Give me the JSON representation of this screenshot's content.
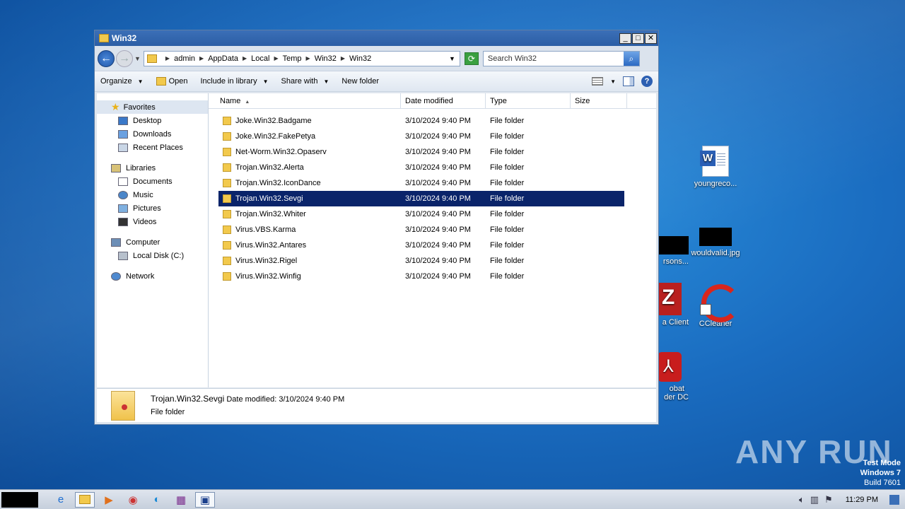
{
  "window": {
    "title": "Win32",
    "controls": {
      "minimize": "_",
      "maximize": "□",
      "close": "✕"
    }
  },
  "address": {
    "crumbs": [
      "admin",
      "AppData",
      "Local",
      "Temp",
      "Win32",
      "Win32"
    ],
    "search_placeholder": "Search Win32"
  },
  "toolbar": {
    "organize": "Organize",
    "open": "Open",
    "include": "Include in library",
    "share": "Share with",
    "newfolder": "New folder"
  },
  "nav": {
    "favorites": "Favorites",
    "desktop": "Desktop",
    "downloads": "Downloads",
    "recent": "Recent Places",
    "libraries": "Libraries",
    "documents": "Documents",
    "music": "Music",
    "pictures": "Pictures",
    "videos": "Videos",
    "computer": "Computer",
    "localdisk": "Local Disk (C:)",
    "network": "Network"
  },
  "columns": {
    "name": "Name",
    "date": "Date modified",
    "type": "Type",
    "size": "Size"
  },
  "files": [
    {
      "name": "Joke.Win32.Badgame",
      "date": "3/10/2024 9:40 PM",
      "type": "File folder"
    },
    {
      "name": "Joke.Win32.FakePetya",
      "date": "3/10/2024 9:40 PM",
      "type": "File folder"
    },
    {
      "name": "Net-Worm.Win32.Opaserv",
      "date": "3/10/2024 9:40 PM",
      "type": "File folder"
    },
    {
      "name": "Trojan.Win32.Alerta",
      "date": "3/10/2024 9:40 PM",
      "type": "File folder"
    },
    {
      "name": "Trojan.Win32.IconDance",
      "date": "3/10/2024 9:40 PM",
      "type": "File folder"
    },
    {
      "name": "Trojan.Win32.Sevgi",
      "date": "3/10/2024 9:40 PM",
      "type": "File folder"
    },
    {
      "name": "Trojan.Win32.Whiter",
      "date": "3/10/2024 9:40 PM",
      "type": "File folder"
    },
    {
      "name": "Virus.VBS.Karma",
      "date": "3/10/2024 9:40 PM",
      "type": "File folder"
    },
    {
      "name": "Virus.Win32.Antares",
      "date": "3/10/2024 9:40 PM",
      "type": "File folder"
    },
    {
      "name": "Virus.Win32.Rigel",
      "date": "3/10/2024 9:40 PM",
      "type": "File folder"
    },
    {
      "name": "Virus.Win32.Winfig",
      "date": "3/10/2024 9:40 PM",
      "type": "File folder"
    }
  ],
  "selected_index": 5,
  "details": {
    "name": "Trojan.Win32.Sevgi",
    "date_label": "Date modified:",
    "date": "3/10/2024 9:40 PM",
    "type": "File folder"
  },
  "desktop_icons": {
    "word": "youngreco...",
    "persons": "rsons...",
    "wouldvalid": "wouldvalid.jpg",
    "filezilla": "a Client",
    "ccleaner": "CCleaner",
    "acrobat_1": "obat",
    "acrobat_2": "der DC"
  },
  "watermark": "ANY RUN",
  "testmode": {
    "line1": "Test Mode",
    "line2": "Windows 7",
    "line3": "Build 7601"
  },
  "taskbar": {
    "clock": "11:29 PM"
  }
}
